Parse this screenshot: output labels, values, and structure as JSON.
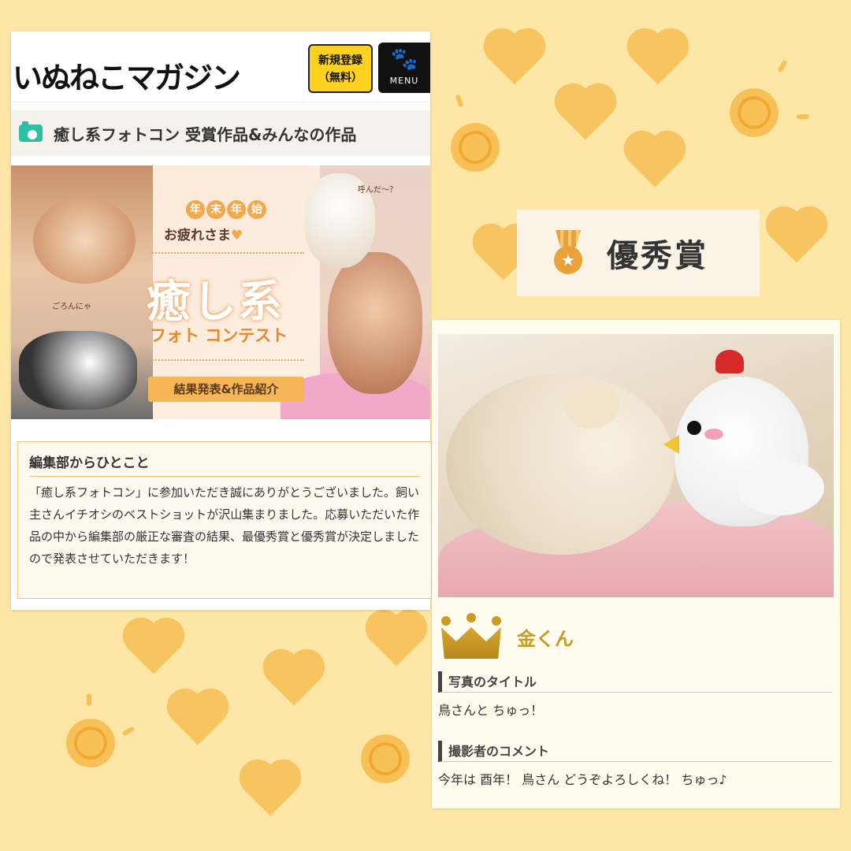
{
  "left_panel": {
    "logo": "いぬねこマガジン",
    "register_button": {
      "line1": "新規登録",
      "line2": "（無料）"
    },
    "menu_button": "MENU",
    "section_title": "癒し系フォトコン 受賞作品&みんなの作品",
    "banner": {
      "tag_chars": [
        "年",
        "末",
        "年",
        "始"
      ],
      "subtitle": "お疲れさま",
      "main_title": "癒し系",
      "contest_label": "フォト コンテスト",
      "result_button": "結果発表&作品紹介",
      "caption_cat": "ごろんにゃ",
      "caption_dog": "呼んだ〜？"
    },
    "editorial": {
      "heading": "編集部からひとこと",
      "body": "「癒し系フォトコン」に参加いただき誠にありがとうございました。飼い主さんイチオシのベストショットが沢山集まりました。応募いただいた作品の中から編集部の厳正な審査の結果、最優秀賞と優秀賞が決定しましたので発表させていただきます！"
    }
  },
  "award": {
    "title": "優秀賞"
  },
  "winner": {
    "name": "金くん",
    "photo_title_label": "写真のタイトル",
    "photo_title": "鳥さんと ちゅっ！",
    "comment_label": "撮影者のコメント",
    "comment": "今年は 酉年！ 鳥さん どうぞよろしくね！ ちゅっ♪"
  }
}
